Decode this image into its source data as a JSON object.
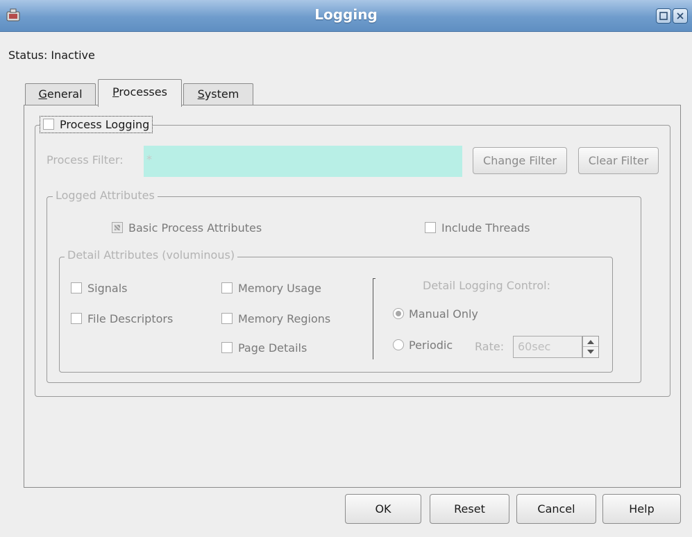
{
  "window": {
    "title": "Logging"
  },
  "status": {
    "label": "Status:",
    "value": "Inactive"
  },
  "tabs": [
    {
      "label": "General",
      "accel": "G",
      "rest": "eneral",
      "selected": false
    },
    {
      "label": "Processes",
      "accel": "P",
      "rest": "rocesses",
      "selected": true
    },
    {
      "label": "System",
      "accel": "S",
      "rest": "ystem",
      "selected": false
    }
  ],
  "process_logging": {
    "label": "Process Logging",
    "checked": false,
    "filter": {
      "label": "Process Filter:",
      "value": "*",
      "change_button": "Change Filter",
      "clear_button": "Clear Filter"
    },
    "logged_attributes": {
      "legend": "Logged Attributes",
      "basic": {
        "label": "Basic Process Attributes",
        "checked": true
      },
      "include_threads": {
        "label": "Include Threads",
        "checked": false
      },
      "detail": {
        "legend": "Detail Attributes (voluminous)",
        "signals": "Signals",
        "file_descriptors": "File Descriptors",
        "memory_usage": "Memory Usage",
        "memory_regions": "Memory Regions",
        "page_details": "Page Details",
        "control": {
          "title": "Detail Logging Control:",
          "manual_only": "Manual Only",
          "periodic": "Periodic",
          "rate_label": "Rate:",
          "rate_value": "60sec",
          "selected": "Manual Only"
        }
      }
    }
  },
  "buttons": {
    "ok": "OK",
    "reset": "Reset",
    "cancel": "Cancel",
    "help": "Help"
  },
  "colors": {
    "titlebar": "#6f9ccc",
    "filter_field_bg": "#b8efe6",
    "disabled_text": "#b3b3b3"
  }
}
